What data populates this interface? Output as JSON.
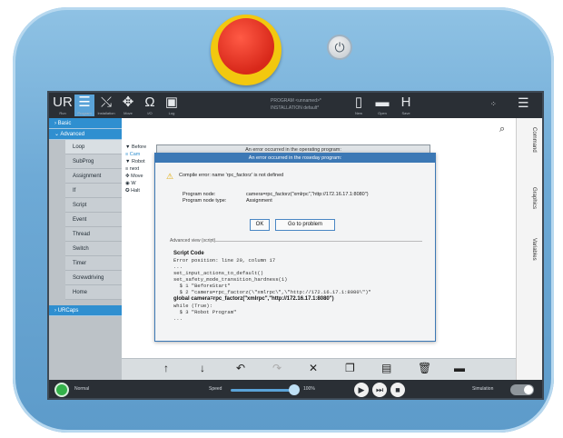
{
  "topbar": {
    "buttons": [
      {
        "icon": "ur-logo-icon",
        "glyph": "UR",
        "label": "Run"
      },
      {
        "icon": "program-icon",
        "glyph": "☰",
        "label": "Program"
      },
      {
        "icon": "installation-icon",
        "glyph": "⤯",
        "label": "Installation"
      },
      {
        "icon": "move-icon",
        "glyph": "✥",
        "label": "Move"
      },
      {
        "icon": "io-icon",
        "glyph": "Ω",
        "label": "I/O"
      },
      {
        "icon": "log-icon",
        "glyph": "▣",
        "label": "Log"
      }
    ],
    "program_line1": "PROGRAM <unnamed>*",
    "program_line2": "INSTALLATION default*",
    "file_buttons": [
      {
        "icon": "new-file-icon",
        "glyph": "▯",
        "label": "New"
      },
      {
        "icon": "open-folder-icon",
        "glyph": "▬",
        "label": "Open"
      },
      {
        "icon": "save-icon",
        "glyph": "H",
        "label": "Save"
      }
    ],
    "hamburger": "☰"
  },
  "sidebar": {
    "groups": [
      "Basic",
      "Advanced",
      "URCaps"
    ],
    "advanced_items": [
      "Loop",
      "SubProg",
      "Assignment",
      "If",
      "Script",
      "Event",
      "Thread",
      "Switch",
      "Timer",
      "Screwdriving",
      "Home"
    ]
  },
  "tree": [
    "▼ Before",
    "  ≡ Cam",
    "▼ Robot",
    "  ≡ next",
    "  ✥ Move",
    "   ◉ W",
    "  ✪ Halt"
  ],
  "right_tabs": [
    "Command",
    "Graphics",
    "Variables"
  ],
  "dialog_back": {
    "title": "An error occurred in the operating program:"
  },
  "dialog": {
    "title": "An error occurred in the roseday program:",
    "message": "Compile error: name 'rpc_factorz' is not defined",
    "program_node_label": "Program node:",
    "program_node_value": "camera=rpc_factorz(\"xmlrpc\",\"http://172.16.17.1:8080\")",
    "node_type_label": "Program node type:",
    "node_type_value": "Assignment",
    "ok_label": "OK",
    "goto_label": "Go to problem",
    "advanced_label": "Advanced view (script)",
    "script_heading": "Script Code",
    "error_position": "Error position: line 20, column 17",
    "code_lines": [
      "...",
      "set_input_actions_to_default()",
      "set_safety_mode_transition_hardness(1)",
      "  $ 1 \"BeforeStart\"",
      "  $ 2 \"camera=rpc_factorz(\\\"xmlrpc\\\",\\\"http://172.16.17.1:8080\\\")\"",
      "global camera=rpc_factorz(\"xmlrpc\",\"http://172.16.17.1:8080\")",
      "while (True):",
      "  $ 3 \"Robot Program\"",
      "..."
    ]
  },
  "bottom_toolbar": [
    "↑",
    "↓",
    "↶",
    "↷",
    "✕",
    "❐",
    "▤",
    "🗑",
    "▬"
  ],
  "status": {
    "mode": "Normal",
    "speed_label": "Speed",
    "speed_value": "100%",
    "simulation_label": "Simulation"
  },
  "colors": {
    "accent": "#2f8fd0",
    "estop": "#d8281a",
    "running": "#34b24a"
  }
}
